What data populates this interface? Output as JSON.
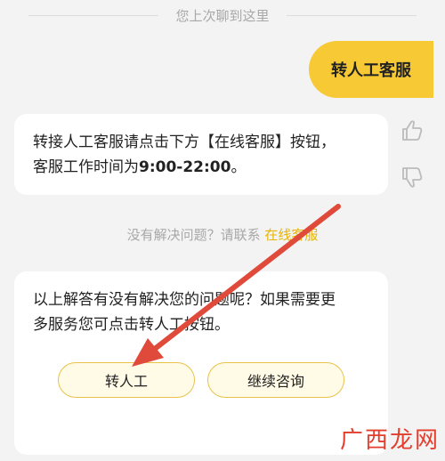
{
  "history_divider": "您上次聊到这里",
  "user_message": "转人工客服",
  "bot_message": {
    "line1": "转接人工客服请点击下方【在线客服】按钮，",
    "line2_prefix": "客服工作时间为",
    "line2_time": "9:00-22:00",
    "line2_suffix": "。"
  },
  "feedback": {
    "like_icon": "thumbs-up-icon",
    "dislike_icon": "thumbs-down-icon"
  },
  "contact": {
    "prefix": "没有解决问题？请联系",
    "link": "在线客服"
  },
  "card": {
    "line1": "以上解答有没有解决您的问题呢？如果需要更",
    "line2": "多服务您可点击转人工按钮。",
    "transfer_button": "转人工",
    "continue_button": "继续咨询"
  },
  "watermark": "广西龙网",
  "colors": {
    "accent": "#f6c935",
    "link": "#e8b400",
    "annotation_arrow": "#e04a3a",
    "watermark": "#e23d2d"
  }
}
